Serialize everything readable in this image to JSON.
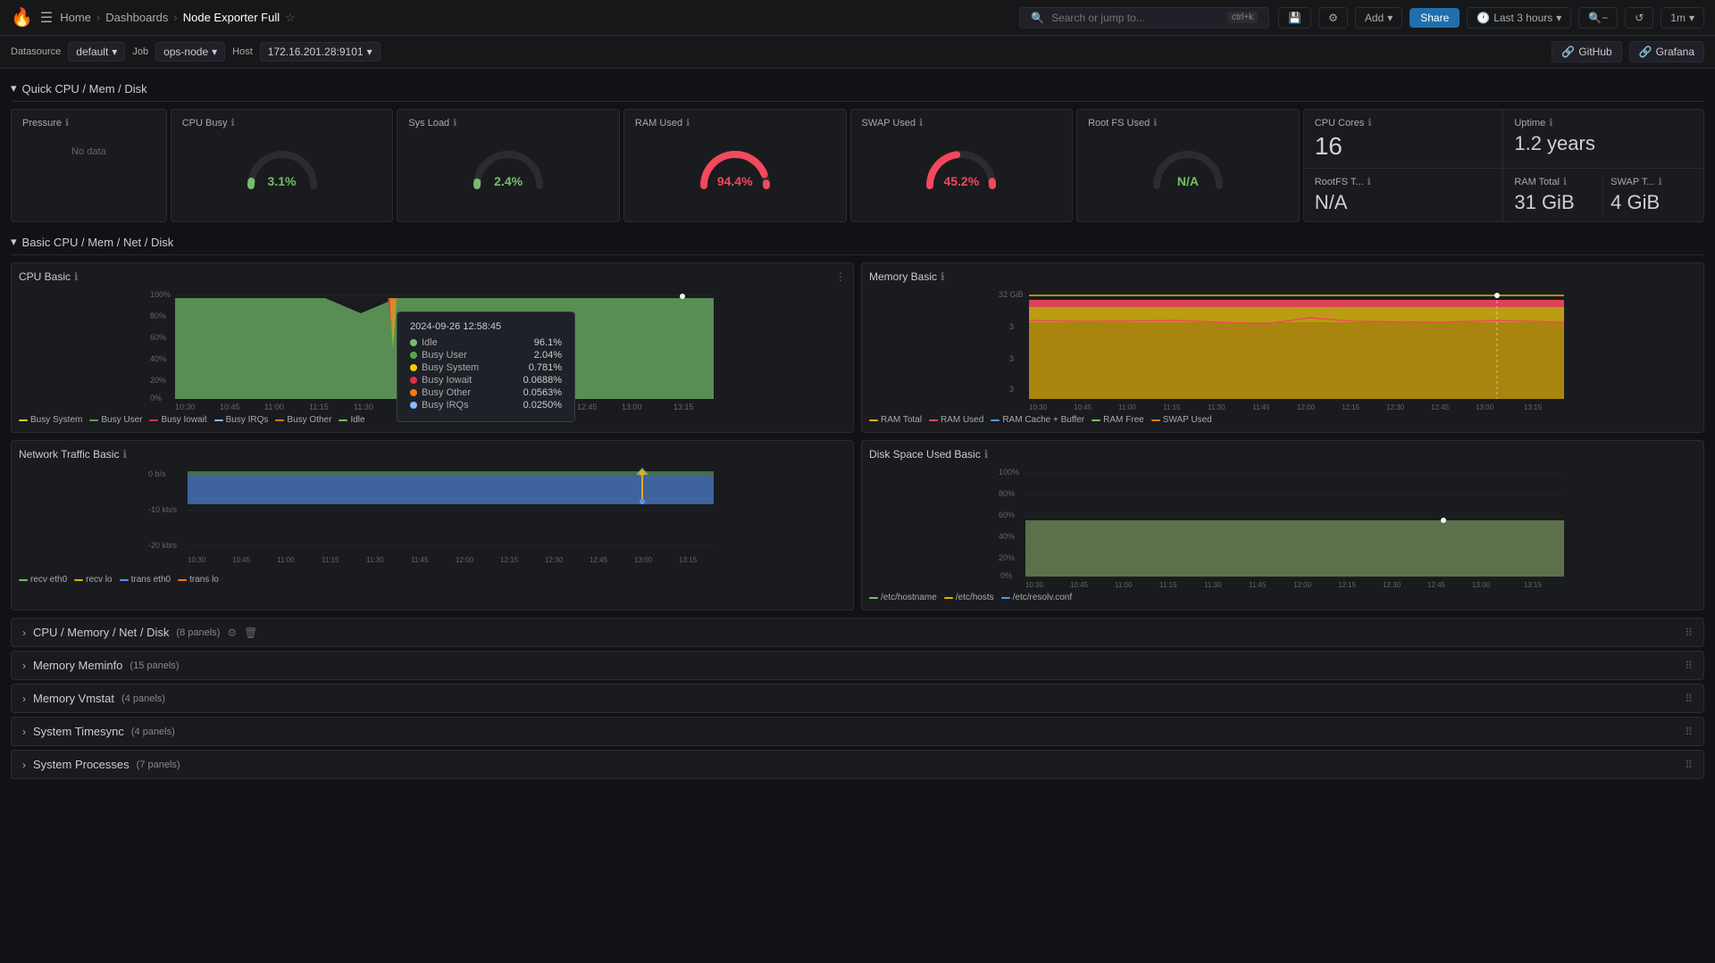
{
  "app": {
    "logo": "🔥",
    "search_placeholder": "Search or jump to...",
    "shortcut": "ctrl+k"
  },
  "nav": {
    "hamburger": "☰",
    "breadcrumb": [
      "Home",
      "Dashboards",
      "Node Exporter Full"
    ],
    "add_label": "Add",
    "share_label": "Share",
    "time_range": "Last 3 hours",
    "refresh_interval": "1m",
    "github_label": "GitHub",
    "grafana_label": "Grafana",
    "star_icon": "☆",
    "settings_icon": "⚙",
    "clock_icon": "🕐"
  },
  "filters": {
    "datasource_label": "Datasource",
    "datasource_value": "default",
    "job_label": "Job",
    "job_value": "ops-node",
    "host_label": "Host",
    "host_value": "172.16.201.28:9101"
  },
  "sections": {
    "quick_cpu": "Quick CPU / Mem / Disk",
    "basic_cpu": "Basic CPU / Mem / Net / Disk",
    "cpu_memory": "CPU / Memory / Net / Disk",
    "cpu_memory_panels": "8 panels",
    "memory_meminfo": "Memory Meminfo",
    "memory_meminfo_panels": "15 panels",
    "memory_vmstat": "Memory Vmstat",
    "memory_vmstat_panels": "4 panels",
    "system_timesync": "System Timesync",
    "system_timesync_panels": "4 panels",
    "system_processes": "System Processes",
    "system_processes_panels": "7 panels"
  },
  "quick_stats": {
    "pressure": {
      "title": "Pressure",
      "value": null,
      "no_data": "No data"
    },
    "cpu_busy": {
      "title": "CPU Busy",
      "value": "3.1%",
      "color": "#73bf69"
    },
    "sys_load": {
      "title": "Sys Load",
      "value": "2.4%",
      "color": "#73bf69"
    },
    "ram_used": {
      "title": "RAM Used",
      "value": "94.4%",
      "color": "#f2495c"
    },
    "swap_used": {
      "title": "SWAP Used",
      "value": "45.2%",
      "color": "#f2495c"
    },
    "root_fs": {
      "title": "Root FS Used",
      "value": "N/A",
      "color": "#73bf69"
    },
    "cpu_cores": {
      "title": "CPU Cores",
      "value": "16"
    },
    "uptime": {
      "title": "Uptime",
      "value": "1.2 years"
    },
    "rootfs_total": {
      "title": "RootFS T...",
      "value": "N/A"
    },
    "ram_total": {
      "title": "RAM Total",
      "value": "31 GiB"
    },
    "swap_total": {
      "title": "SWAP T...",
      "value": "4 GiB"
    }
  },
  "cpu_chart": {
    "title": "CPU Basic",
    "legend": [
      {
        "label": "Busy System",
        "color": "#f2cc0c"
      },
      {
        "label": "Busy User",
        "color": "#56a64b"
      },
      {
        "label": "Busy Iowait",
        "color": "#e02f44"
      },
      {
        "label": "Busy IRQs",
        "color": "#8ab8ff"
      },
      {
        "label": "Busy Other",
        "color": "#ff780a"
      },
      {
        "label": "Idle",
        "color": "#5794f2"
      }
    ],
    "y_labels": [
      "100%",
      "80%",
      "60%",
      "40%",
      "20%",
      "0%"
    ],
    "x_labels": [
      "10:30",
      "10:45",
      "11:00",
      "11:15",
      "11:30",
      "11:45",
      "12:00",
      "12:15",
      "12:30",
      "12:45",
      "13:00",
      "13:15"
    ],
    "tooltip": {
      "timestamp": "2024-09-26 12:58:45",
      "idle": "96.1%",
      "busy_user": "2.04%",
      "busy_system": "0.781%",
      "busy_iowait": "0.0688%",
      "busy_other": "0.0563%",
      "busy_irqs": "0.0250%"
    }
  },
  "memory_chart": {
    "title": "Memory Basic",
    "legend": [
      {
        "label": "RAM Total",
        "color": "#e0b400"
      },
      {
        "label": "RAM Used",
        "color": "#f2495c"
      },
      {
        "label": "RAM Cache + Buffer",
        "color": "#5794f2"
      },
      {
        "label": "RAM Free",
        "color": "#73bf69"
      },
      {
        "label": "SWAP Used",
        "color": "#ff780a"
      }
    ],
    "y_labels": [
      "32 GiB",
      "3",
      "3",
      "3"
    ],
    "x_labels": [
      "10:30",
      "10:45",
      "11:00",
      "11:15",
      "11:30",
      "11:45",
      "12:00",
      "12:15",
      "12:30",
      "12:45",
      "13:00",
      "13:15",
      "13:15"
    ]
  },
  "network_chart": {
    "title": "Network Traffic Basic",
    "legend": [
      {
        "label": "recv eth0",
        "color": "#73bf69"
      },
      {
        "label": "recv lo",
        "color": "#e0b400"
      },
      {
        "label": "trans eth0",
        "color": "#5794f2"
      },
      {
        "label": "trans lo",
        "color": "#ff780a"
      }
    ],
    "y_labels": [
      "0 b/s",
      "-10 kb/s",
      "-20 kb/s"
    ],
    "x_labels": [
      "10:30",
      "10:45",
      "11:00",
      "11:15",
      "11:30",
      "11:45",
      "12:00",
      "12:15",
      "12:30",
      "12:45",
      "13:00",
      "13:15",
      "13:15"
    ]
  },
  "disk_chart": {
    "title": "Disk Space Used Basic",
    "legend": [
      {
        "label": "/etc/hostname",
        "color": "#73bf69"
      },
      {
        "label": "/etc/hosts",
        "color": "#e0b400"
      },
      {
        "label": "/etc/resolv.conf",
        "color": "#5794f2"
      }
    ],
    "y_labels": [
      "100%",
      "80%",
      "60%",
      "40%",
      "20%",
      "0%"
    ],
    "x_labels": [
      "10:30",
      "10:45",
      "11:00",
      "11:15",
      "11:30",
      "11:45",
      "12:00",
      "12:15",
      "12:30",
      "12:45",
      "13:00",
      "13:15",
      "13:15"
    ]
  }
}
